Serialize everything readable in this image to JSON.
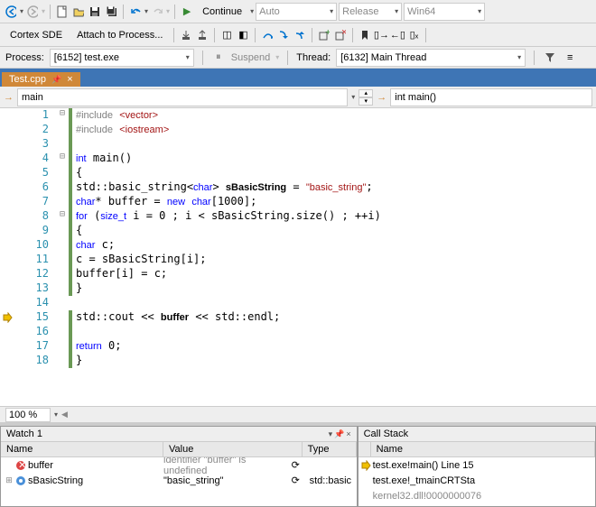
{
  "toolbar1": {
    "continue": "Continue",
    "config": "Auto",
    "build": "Release",
    "platform": "Win64"
  },
  "toolbar2": {
    "cortex": "Cortex SDE",
    "attach": "Attach to Process..."
  },
  "procbar": {
    "process_lbl": "Process:",
    "process_val": "[6152] test.exe",
    "suspend": "Suspend",
    "thread_lbl": "Thread:",
    "thread_val": "[6132] Main Thread"
  },
  "tab": {
    "name": "Test.cpp"
  },
  "nav": {
    "scope": "main",
    "func": "int main()"
  },
  "code": {
    "l1": "#include <vector>",
    "l2": "#include <iostream>",
    "l3": "",
    "l4": "int main()",
    "l5": "{",
    "l6": "    std::basic_string<char> sBasicString = \"basic_string\";",
    "l7": "    char* buffer = new char[1000];",
    "l8": "    for (size_t i = 0 ; i < sBasicString.size() ; ++i)",
    "l9": "    {",
    "l10": "        char c;",
    "l11": "        c = sBasicString[i];",
    "l12": "        buffer[i] = c;",
    "l13": "    }",
    "l14": "",
    "l15": "    std::cout << buffer << std::endl;",
    "l16": "",
    "l17": "    return 0;",
    "l18": "}"
  },
  "zoom": "100 %",
  "watch": {
    "title": "Watch 1",
    "col_name": "Name",
    "col_value": "Value",
    "col_type": "Type",
    "r1_name": "buffer",
    "r1_value": "identifier \"buffer\" is undefined",
    "r2_name": "sBasicString",
    "r2_value": "\"basic_string\"",
    "r2_type": "std::basic"
  },
  "stack": {
    "title": "Call Stack",
    "col_name": "Name",
    "r1": "test.exe!main() Line 15",
    "r2": "test.exe!_tmainCRTSta",
    "r3": "kernel32.dll!0000000076"
  }
}
